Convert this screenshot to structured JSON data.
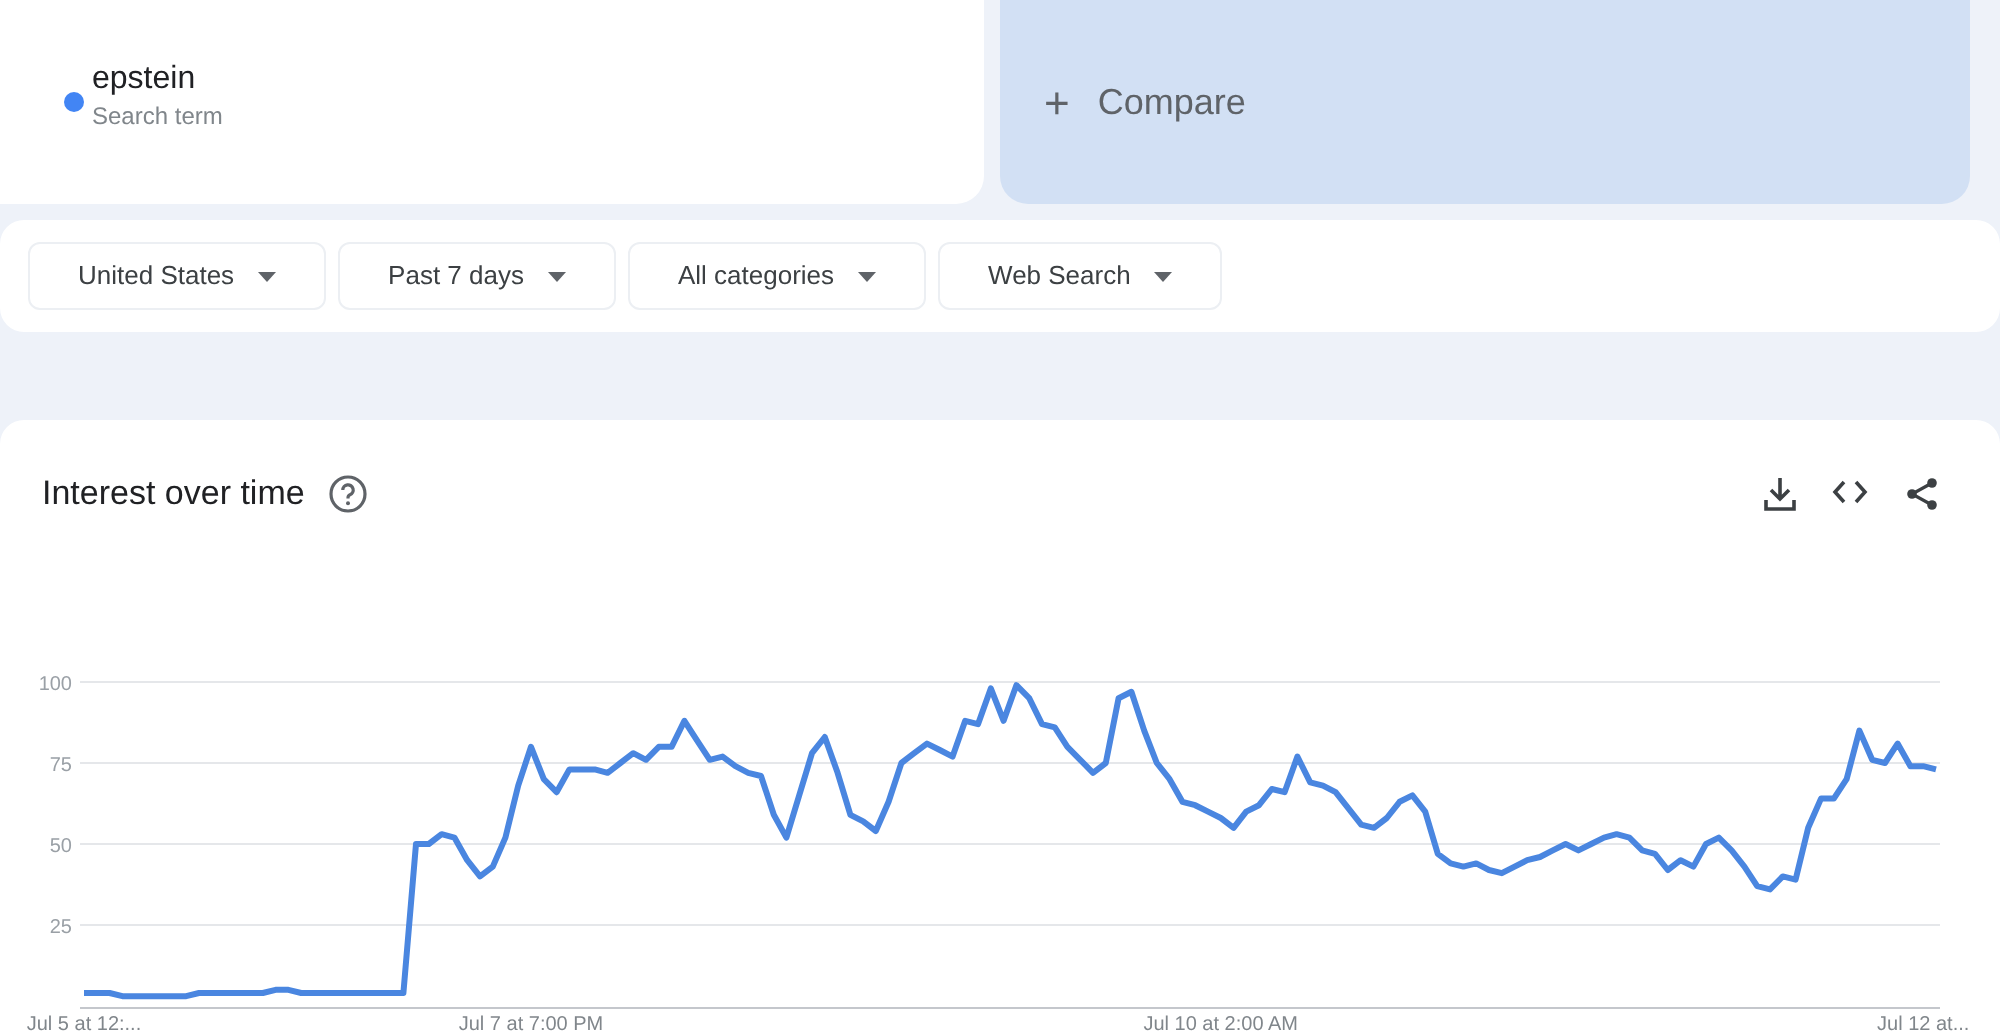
{
  "search_term": {
    "term": "epstein",
    "caption": "Search term"
  },
  "compare": {
    "icon": "+",
    "label": "Compare"
  },
  "filters": [
    {
      "label": "United States"
    },
    {
      "label": "Past 7 days"
    },
    {
      "label": "All categories"
    },
    {
      "label": "Web Search"
    }
  ],
  "interest_over_time": {
    "title": "Interest over time",
    "chart_data": {
      "type": "line",
      "grid": true,
      "ylim": [
        0,
        100
      ],
      "yticks": [
        25,
        50,
        75,
        100
      ],
      "categories": [
        "Jul 5 at 12:...",
        null,
        null,
        null,
        null,
        null,
        null,
        null,
        null,
        null,
        null,
        null,
        null,
        null,
        null,
        null,
        null,
        null,
        null,
        null,
        null,
        null,
        null,
        null,
        null,
        null,
        null,
        null,
        null,
        null,
        null,
        null,
        null,
        null,
        null,
        "Jul 7 at 7:00 PM",
        null,
        null,
        null,
        null,
        null,
        null,
        null,
        null,
        null,
        null,
        null,
        null,
        null,
        null,
        null,
        null,
        null,
        null,
        null,
        null,
        null,
        null,
        null,
        null,
        null,
        null,
        null,
        null,
        null,
        null,
        null,
        null,
        null,
        null,
        null,
        null,
        null,
        null,
        null,
        null,
        null,
        null,
        null,
        null,
        null,
        null,
        null,
        null,
        null,
        null,
        null,
        null,
        null,
        "Jul 10 at 2:00 AM",
        null,
        null,
        null,
        null,
        null,
        null,
        null,
        null,
        null,
        null,
        null,
        null,
        null,
        null,
        null,
        null,
        null,
        null,
        null,
        null,
        null,
        null,
        null,
        null,
        null,
        null,
        null,
        null,
        null,
        null,
        null,
        null,
        null,
        null,
        null,
        null,
        null,
        null,
        null,
        null,
        null,
        null,
        null,
        null,
        null,
        null,
        null,
        null,
        null,
        null,
        null,
        null,
        null,
        null,
        "Jul 12 at...",
        null
      ],
      "series": [
        {
          "color": "#4a86e0",
          "values": [
            4,
            4,
            4,
            3,
            3,
            3,
            3,
            3,
            3,
            4,
            4,
            4,
            4,
            4,
            4,
            5,
            5,
            4,
            4,
            4,
            4,
            4,
            4,
            4,
            4,
            4,
            50,
            50,
            53,
            52,
            45,
            40,
            43,
            52,
            68,
            80,
            70,
            66,
            73,
            73,
            73,
            72,
            75,
            78,
            76,
            80,
            80,
            88,
            82,
            76,
            77,
            74,
            72,
            71,
            59,
            52,
            65,
            78,
            83,
            72,
            59,
            57,
            54,
            63,
            75,
            78,
            81,
            79,
            77,
            88,
            87,
            98,
            88,
            99,
            95,
            87,
            86,
            80,
            76,
            72,
            75,
            95,
            97,
            85,
            75,
            70,
            63,
            62,
            60,
            58,
            55,
            60,
            62,
            67,
            66,
            77,
            69,
            68,
            66,
            61,
            56,
            55,
            58,
            63,
            65,
            60,
            47,
            44,
            43,
            44,
            42,
            41,
            43,
            45,
            46,
            48,
            50,
            48,
            50,
            52,
            53,
            52,
            48,
            47,
            42,
            45,
            43,
            50,
            52,
            48,
            43,
            37,
            36,
            40,
            39,
            55,
            64,
            64,
            70,
            85,
            76,
            75,
            81,
            74,
            74,
            73
          ]
        }
      ]
    }
  }
}
